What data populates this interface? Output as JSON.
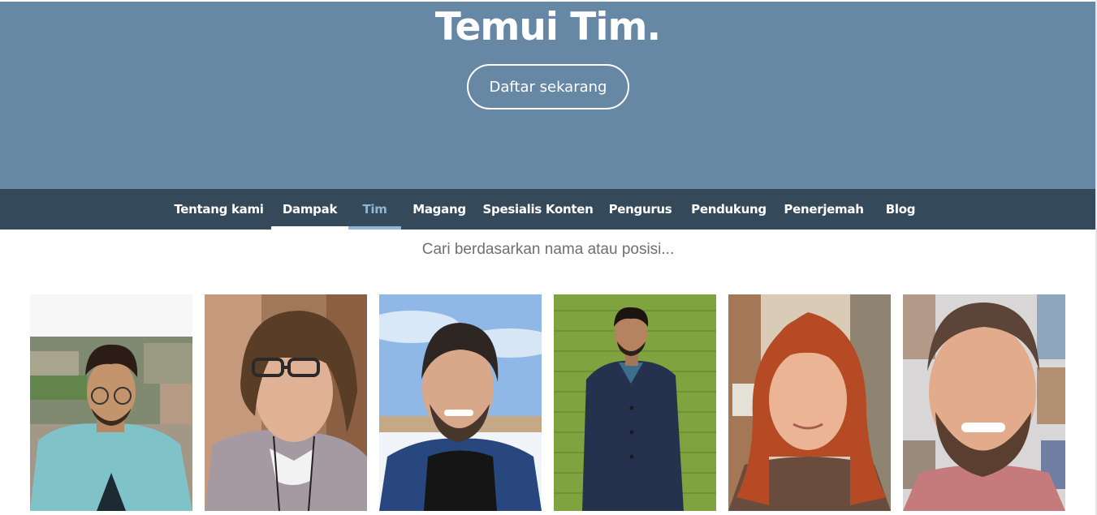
{
  "hero": {
    "title": "Temui Tim.",
    "cta_label": "Daftar sekarang",
    "background": "#6688a4"
  },
  "nav": {
    "background": "#34495a",
    "active_color": "#8fb6d8",
    "tabs": [
      {
        "label": "Tentang kami"
      },
      {
        "label": "Dampak",
        "state": "underlined"
      },
      {
        "label": "Tim",
        "state": "current"
      },
      {
        "label": "Magang"
      },
      {
        "label": "Spesialis Konten"
      },
      {
        "label": "Pengurus"
      },
      {
        "label": "Pendukung"
      },
      {
        "label": "Penerjemah"
      },
      {
        "label": "Blog"
      }
    ]
  },
  "search": {
    "placeholder": "Cari berdasarkan nama atau posisi...",
    "value": ""
  },
  "team": {
    "members": [
      {
        "photo": "team-member-photo-1"
      },
      {
        "photo": "team-member-photo-2"
      },
      {
        "photo": "team-member-photo-3"
      },
      {
        "photo": "team-member-photo-4"
      },
      {
        "photo": "team-member-photo-5"
      },
      {
        "photo": "team-member-photo-6"
      }
    ]
  }
}
